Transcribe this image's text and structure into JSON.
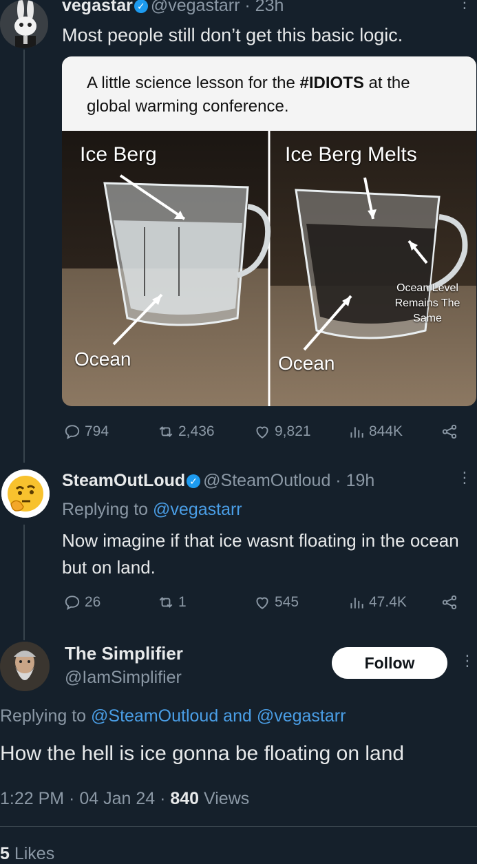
{
  "tweet1": {
    "display_name": "vegastar",
    "handle_time": "@vegastarr · 23h",
    "text": "Most people still don’t get this basic logic.",
    "image": {
      "header_text_pre": "A little science lesson for the ",
      "header_text_bold": "#IDIOTS",
      "header_text_post": " at the global warming conference.",
      "left_title": "Ice Berg",
      "right_title": "Ice Berg Melts",
      "left_ocean": "Ocean",
      "right_ocean": "Ocean",
      "ocean_level_note_line1": "Ocean Level",
      "ocean_level_note_line2": "Remains The",
      "ocean_level_note_line3": "Same"
    },
    "replies": "794",
    "reposts": "2,436",
    "likes": "9,821",
    "views": "844K"
  },
  "tweet2": {
    "display_name": "SteamOutLoud",
    "handle_time": "@SteamOutloud · 19h",
    "replying_prefix": "Replying to ",
    "replying_to": "@vegastarr",
    "text": "Now imagine if that ice wasnt floating in the ocean but on land.",
    "replies": "26",
    "reposts": "1",
    "likes": "545",
    "views": "47.4K"
  },
  "tweet3": {
    "display_name": "The Simplifier",
    "handle": "@IamSimplifier",
    "follow_label": "Follow",
    "replying_prefix": "Replying to ",
    "replying_to_1": "@SteamOutloud",
    "replying_and": " and ",
    "replying_to_2": "@vegastarr",
    "text": "How the hell is ice gonna be floating on land",
    "time_date": "1:22 PM · 04 Jan 24 · ",
    "views_count": "840",
    "views_label": " Views",
    "likes_count": "5",
    "likes_label": " Likes"
  },
  "colors": {
    "background": "#15202b",
    "link": "#4a9ee6",
    "verified": "#1d9bf0"
  }
}
